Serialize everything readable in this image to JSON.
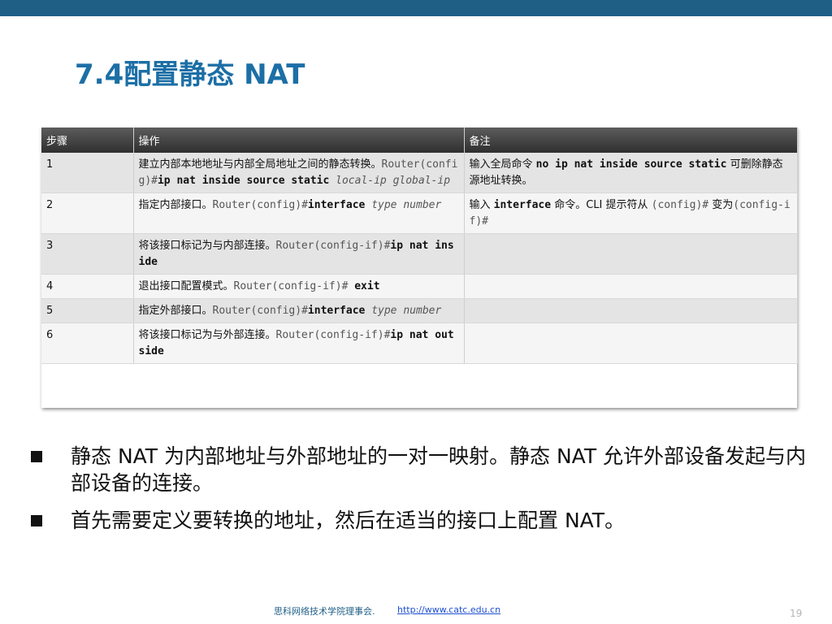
{
  "title": "7.4配置静态 NAT",
  "table": {
    "headers": [
      "步骤",
      "操作",
      "备注"
    ],
    "rows": [
      {
        "step": "1",
        "op": [
          {
            "t": "建立内部本地地址与内部全局地址之间的静态转换。",
            "s": "cn"
          },
          {
            "t": "Router(config)#",
            "s": "mono"
          },
          {
            "t": "ip nat inside source static",
            "s": "mono-b"
          },
          {
            "t": " local-ip global-ip",
            "s": "mono-i"
          }
        ],
        "note": [
          {
            "t": "输入全局命令 ",
            "s": "cn"
          },
          {
            "t": "no ip nat inside source static",
            "s": "mono-b"
          },
          {
            "t": " 可删除静态源地址转换。",
            "s": "cn"
          }
        ]
      },
      {
        "step": "2",
        "op": [
          {
            "t": "指定内部接口。",
            "s": "cn"
          },
          {
            "t": "Router(config)#",
            "s": "mono"
          },
          {
            "t": "interface",
            "s": "mono-b"
          },
          {
            "t": " type number",
            "s": "mono-i"
          }
        ],
        "note": [
          {
            "t": "输入 ",
            "s": "cn"
          },
          {
            "t": "interface",
            "s": "mono-b"
          },
          {
            "t": " 命令。CLI 提示符从 ",
            "s": "cn"
          },
          {
            "t": "(config)#",
            "s": "mono"
          },
          {
            "t": " 变为",
            "s": "cn"
          },
          {
            "t": "(config-if)#",
            "s": "mono"
          }
        ]
      },
      {
        "step": "3",
        "op": [
          {
            "t": "将该接口标记为与内部连接。",
            "s": "cn"
          },
          {
            "t": "Router(config-if)#",
            "s": "mono"
          },
          {
            "t": "ip nat inside",
            "s": "mono-b"
          }
        ],
        "note": []
      },
      {
        "step": "4",
        "op": [
          {
            "t": "退出接口配置模式。",
            "s": "cn"
          },
          {
            "t": "Router(config-if)# ",
            "s": "mono"
          },
          {
            "t": "exit",
            "s": "mono-b"
          }
        ],
        "note": []
      },
      {
        "step": "5",
        "op": [
          {
            "t": "指定外部接口。",
            "s": "cn"
          },
          {
            "t": "Router(config)#",
            "s": "mono"
          },
          {
            "t": "interface",
            "s": "mono-b"
          },
          {
            "t": " type number",
            "s": "mono-i"
          }
        ],
        "note": []
      },
      {
        "step": "6",
        "op": [
          {
            "t": "将该接口标记为与外部连接。",
            "s": "cn"
          },
          {
            "t": "Router(config-if)#",
            "s": "mono"
          },
          {
            "t": "ip nat outside",
            "s": "mono-b"
          }
        ],
        "note": []
      }
    ]
  },
  "bullets": [
    "静态 NAT 为内部地址与外部地址的一对一映射。静态 NAT 允许外部设备发起与内部设备的连接。",
    "首先需要定义要转换的地址，然后在适当的接口上配置 NAT。"
  ],
  "footer": {
    "org": "思科网络技术学院理事会.",
    "link": "http://www.catc.edu.cn",
    "page": "19"
  },
  "colors": {
    "top_band": "#1f5f86",
    "title": "#1c6fa6",
    "header_bg": "#3a3a3a"
  }
}
